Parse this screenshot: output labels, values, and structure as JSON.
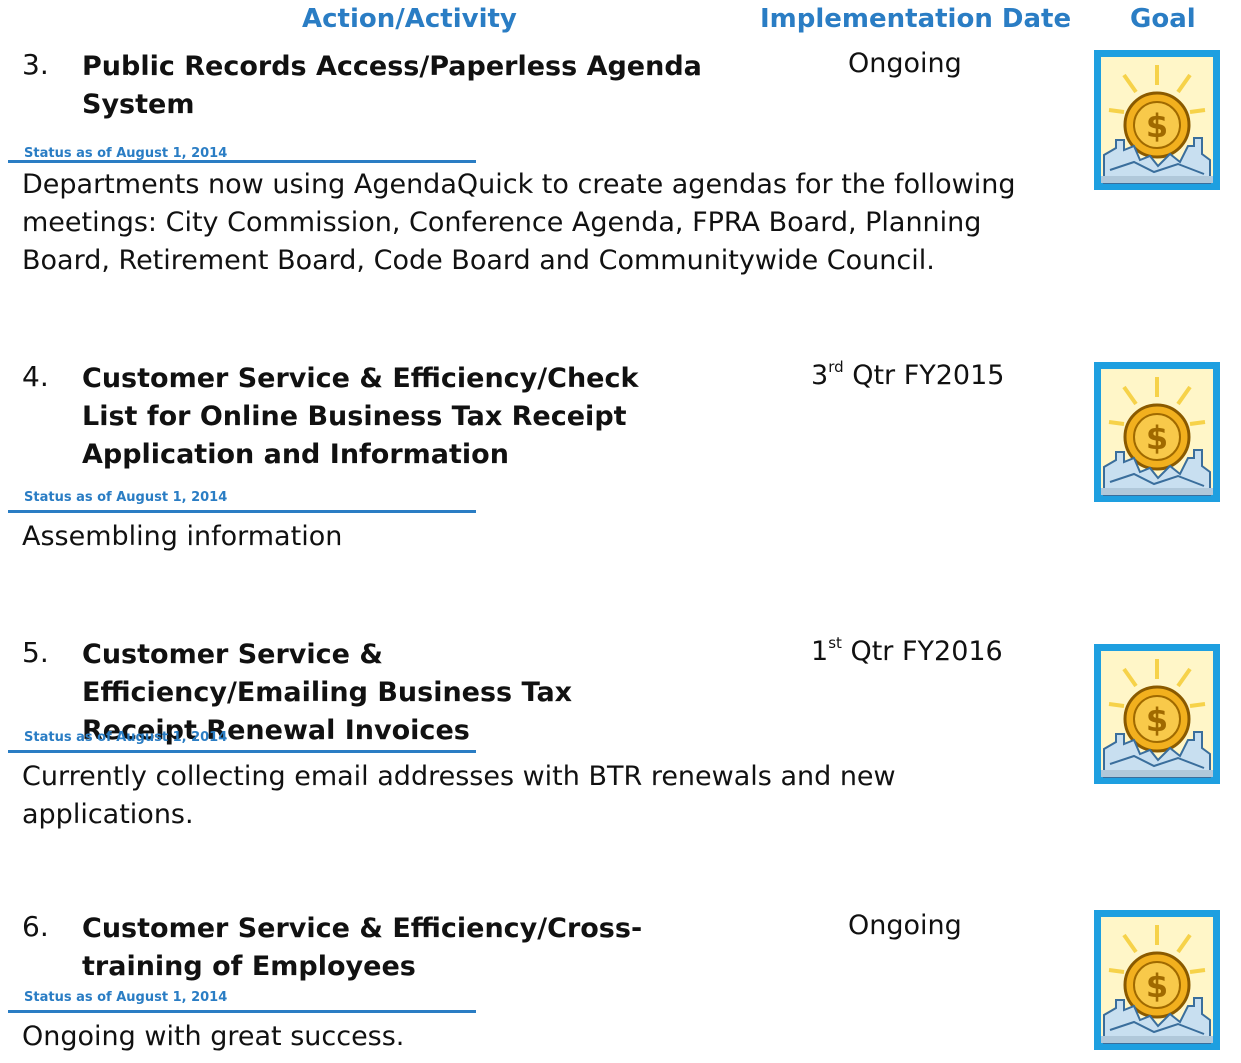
{
  "header": {
    "action": "Action/Activity",
    "date": "Implementation Date",
    "goal": "Goal"
  },
  "items": [
    {
      "number": "3.",
      "title": "Public Records Access/Paperless Agenda System",
      "date_main": "Ongoing",
      "date_sup": "",
      "date_suffix": "",
      "status_label": "Status as of August 1, 2014",
      "description": "Departments now using AgendaQuick to create agendas for the following meetings:  City Commission, Conference Agenda, FPRA Board, Planning Board, Retirement Board, Code Board and Communitywide Council.",
      "goal_icon": "economic-development-sun-icon"
    },
    {
      "number": "4.",
      "title": "Customer Service & Efficiency/Check List for Online Business Tax Receipt Application and Information",
      "date_main": "3",
      "date_sup": "rd",
      "date_suffix": " Qtr FY2015",
      "status_label": "Status as of August 1, 2014",
      "description": "Assembling information",
      "goal_icon": "economic-development-sun-icon"
    },
    {
      "number": "5.",
      "title": "Customer Service & Efficiency/Emailing Business Tax Receipt Renewal Invoices",
      "date_main": "1",
      "date_sup": "st",
      "date_suffix": " Qtr FY2016",
      "status_label": "Status as of August 1, 2014",
      "description": "Currently collecting email addresses with BTR renewals and new applications.",
      "goal_icon": "economic-development-sun-icon"
    },
    {
      "number": "6.",
      "title": "Customer Service & Efficiency/Cross-training of Employees",
      "date_main": "Ongoing",
      "date_sup": "",
      "date_suffix": "",
      "status_label": "Status as of August 1, 2014",
      "description": "Ongoing with great success.",
      "goal_icon": "economic-development-sun-icon"
    }
  ],
  "colors": {
    "accent": "#2a7dc4",
    "goal_frame": "#1e9fe0",
    "goal_coin": "#f2b01e"
  }
}
